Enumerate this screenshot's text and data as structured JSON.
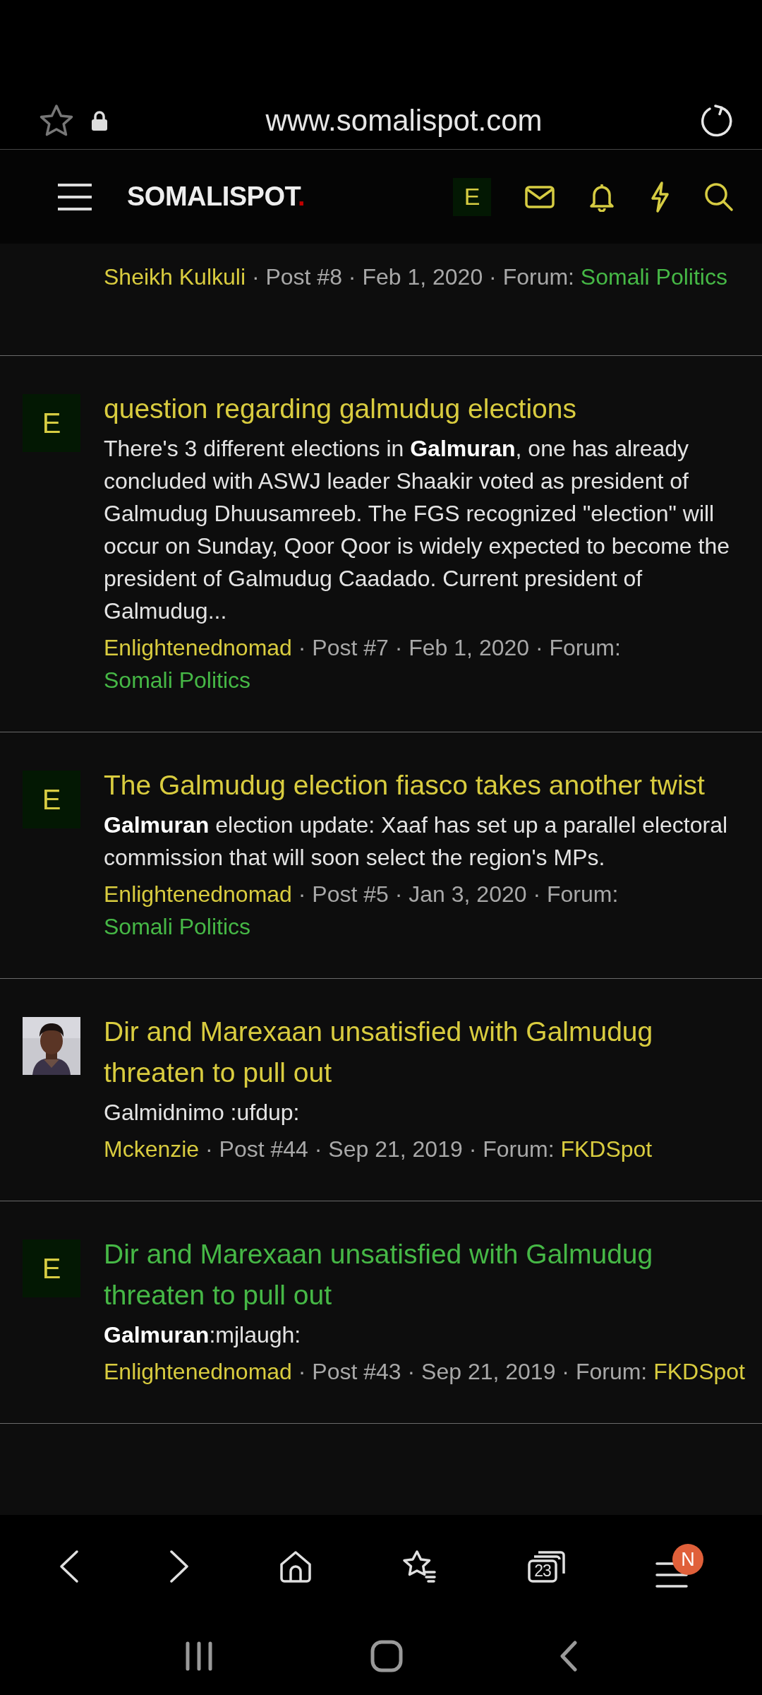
{
  "browser": {
    "url": "www.somalispot.com",
    "secure": true
  },
  "site_header": {
    "logo": "SOMALISPOT",
    "logo_mark": ".",
    "account_letter": "E"
  },
  "results": [
    {
      "kind": "meta_only",
      "author": "Sheikh Kulkuli",
      "details": "· Post #8 · Feb 1, 2020 · Forum:",
      "forum": "Somali Politics",
      "forum_visited": true
    },
    {
      "kind": "post",
      "avatar": {
        "kind": "letter",
        "letter": "E"
      },
      "title": "question regarding galmudug elections",
      "title_visited": false,
      "snippet": "There's 3 different elections in **Galmuran**, one has already concluded with ASWJ leader Shaakir voted as president of Galmudug Dhuusamreeb. The FGS recognized \"election\" will occur on Sunday, Qoor Qoor is widely expected to become the president of Galmudug Caadado. Current president of Galmudug...",
      "author": "Enlightenednomad",
      "details": "· Post #7 · Feb 1, 2020 · Forum:",
      "forum": "Somali Politics",
      "forum_visited": true
    },
    {
      "kind": "post",
      "avatar": {
        "kind": "letter",
        "letter": "E"
      },
      "title": "The Galmudug election fiasco takes another twist",
      "title_visited": false,
      "snippet": "**Galmuran** election update: Xaaf has set up a parallel electoral commission that will soon select the region's MPs.",
      "author": "Enlightenednomad",
      "details": "· Post #5 · Jan 3, 2020 · Forum:",
      "forum": "Somali Politics",
      "forum_visited": true
    },
    {
      "kind": "post",
      "title": "Dir and Marexaan unsatisfied with Galmudug threaten to pull out",
      "title_visited": false,
      "snippet": "Galmidnimo :ufdup:",
      "author": "Mckenzie",
      "details": "· Post #44 · Sep 21, 2019 · Forum:",
      "forum": "FKDSpot",
      "forum_visited": false
    },
    {
      "kind": "post",
      "avatar": {
        "kind": "letter",
        "letter": "E"
      },
      "title": "Dir and Marexaan unsatisfied with Galmudug threaten to pull out",
      "title_visited": true,
      "snippet": "**Galmuran**:mjlaugh:",
      "author": "Enlightenednomad",
      "details": "· Post #43 · Sep 21, 2019 · Forum:",
      "forum": "FKDSpot",
      "forum_visited": false
    }
  ],
  "bottom_bar": {
    "tabs_count": "23",
    "menu_badge": "N"
  }
}
